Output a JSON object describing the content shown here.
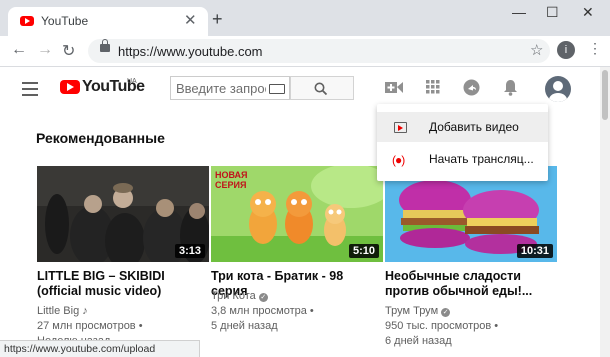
{
  "browser": {
    "tab_title": "YouTube",
    "tab_close": "✕",
    "new_tab": "+",
    "url": "https://www.youtube.com",
    "profile_initial": "i",
    "status_url": "https://www.youtube.com/upload"
  },
  "header": {
    "logo_text": "YouTube",
    "logo_region": "UA",
    "search_placeholder": "Введите запрос"
  },
  "section": {
    "title": "Рекомендованные"
  },
  "videos": [
    {
      "title": "LITTLE BIG – SKIBIDI (official music video)",
      "channel": "Little Big",
      "views": "27 млн просмотров",
      "age": "Неделю назад",
      "duration": "3:13"
    },
    {
      "title": "Три кота - Братик - 98 серия",
      "channel": "Три Кота",
      "views": "3,8 млн просмотра",
      "age": "5 дней назад",
      "duration": "5:10"
    },
    {
      "title": "Необычные сладости против обычной еды!...",
      "channel": "Трум Трум",
      "views": "950 тыс. просмотров",
      "age": "6 дней назад",
      "duration": "10:31"
    }
  ],
  "thumb2_text": "НОВАЯ СЕРИЯ",
  "dropdown": {
    "items": [
      {
        "label": "Добавить видео"
      },
      {
        "label": "Начать трансляц..."
      }
    ]
  }
}
